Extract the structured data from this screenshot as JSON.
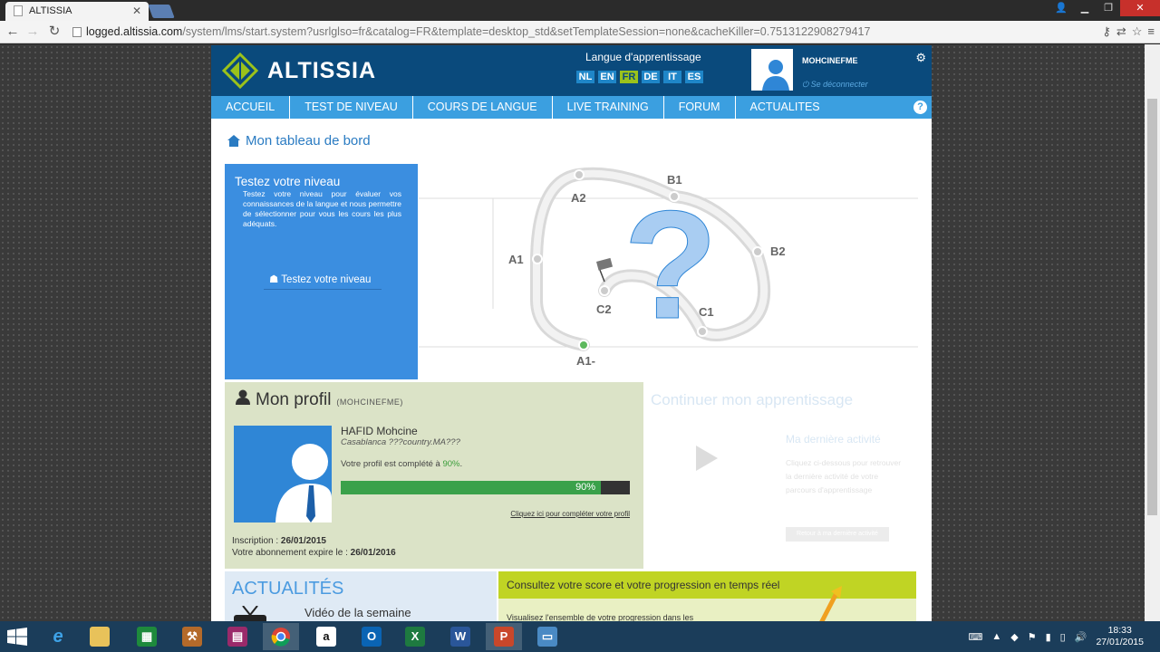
{
  "browser": {
    "tab_title": "ALTISSIA",
    "url_domain": "logged.altissia.com",
    "url_path": "/system/lms/start.system?usrlglso=fr&catalog=FR&template=desktop_std&setTemplateSession=none&cacheKiller=0.7513122908279417"
  },
  "header": {
    "brand": "ALTISSIA",
    "lang_title": "Langue d'apprentissage",
    "languages": [
      "NL",
      "EN",
      "FR",
      "DE",
      "IT",
      "ES"
    ],
    "active_language": "FR",
    "username": "MOHCINEFME",
    "logout_label": "Se déconnecter"
  },
  "menu": {
    "items": [
      "ACCUEIL",
      "TEST DE NIVEAU",
      "COURS DE LANGUE",
      "LIVE TRAINING",
      "FORUM",
      "ACTUALITES"
    ]
  },
  "breadcrumb": {
    "label": "Mon tableau de bord"
  },
  "level": {
    "title": "Testez votre niveau",
    "description": "Testez votre niveau pour évaluer vos connaissances de la langue et nous permettre de sélectionner pour vous les cours les plus adéquats.",
    "button": "Testez votre niveau",
    "levels": [
      "A1-",
      "A1",
      "A2",
      "B1",
      "B2",
      "C1",
      "C2"
    ]
  },
  "profile": {
    "title": "Mon profil",
    "username_tag": "(MOHCINEFME)",
    "full_name": "HAFID Mohcine",
    "location": "Casablanca ???country.MA???",
    "complete_text": "Votre profil est complété à",
    "complete_pct": "90%",
    "complete_fraction": 0.9,
    "complete_link": "Cliquez ici pour compléter votre profil",
    "inscription_label": "Inscription :",
    "inscription_date": "26/01/2015",
    "expiry_label": "Votre abonnement expire le :",
    "expiry_date": "26/01/2016"
  },
  "continue": {
    "title": "Continuer mon apprentissage",
    "subtitle": "Ma dernière activité",
    "text": "Cliquez ci-dessous pour retrouver la dernière activité de votre parcours d'apprentissage",
    "button": "Retour à ma dernière activité"
  },
  "news": {
    "title": "ACTUALITÉS",
    "video": "Vidéo de la semaine"
  },
  "score": {
    "title": "Consultez votre score et votre progression en temps réel",
    "text": "Visualisez l'ensemble de votre progression dans les"
  },
  "taskbar": {
    "time": "18:33",
    "date": "27/01/2015"
  },
  "colors": {
    "header": "#0a4a7c",
    "menu": "#3b9fe0",
    "accent_green": "#9bc21b",
    "progress": "#3aa14a"
  }
}
